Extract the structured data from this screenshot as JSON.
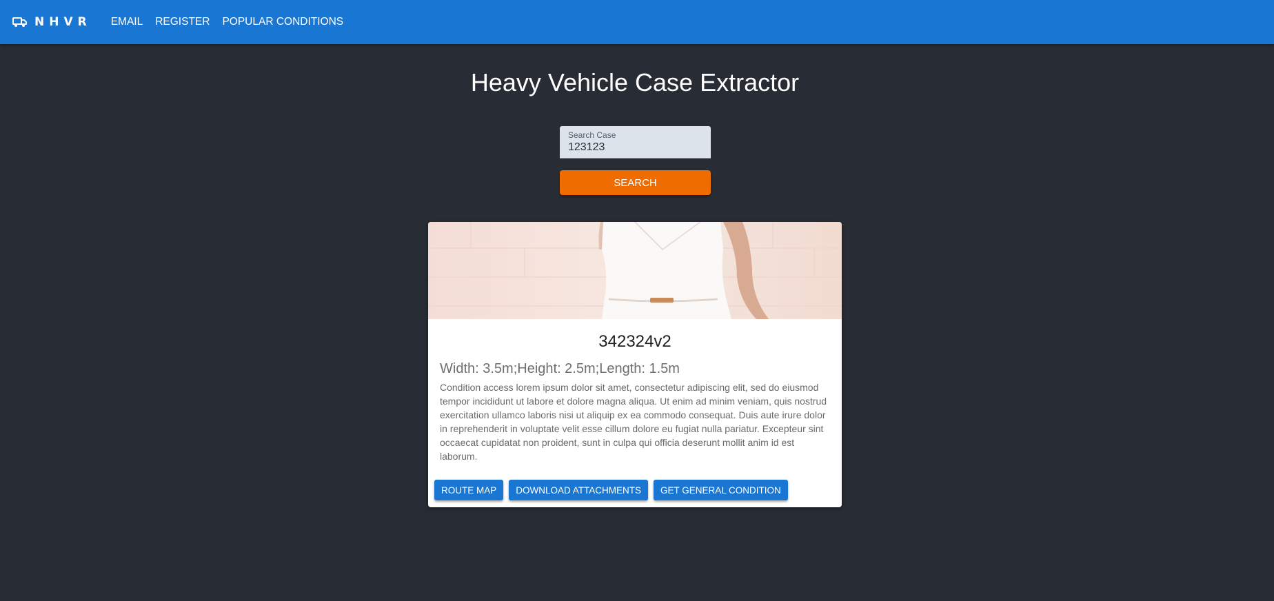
{
  "header": {
    "brand": "NHVR",
    "brand_icon": "truck-icon",
    "nav": [
      {
        "label": "EMAIL"
      },
      {
        "label": "REGISTER"
      },
      {
        "label": "POPULAR CONDITIONS"
      }
    ],
    "color": "#1976d2"
  },
  "main": {
    "title": "Heavy Vehicle Case Extractor",
    "search": {
      "label": "Search Case",
      "value": "123123"
    },
    "search_button": "SEARCH",
    "search_button_color": "#ef6c00"
  },
  "card": {
    "title": "342324v2",
    "dimensions": "Width: 3.5m;Height: 2.5m;Length: 1.5m",
    "description": "Condition access lorem ipsum dolor sit amet, consectetur adipiscing elit, sed do eiusmod tempor incididunt ut labore et dolore magna aliqua. Ut enim ad minim veniam, quis nostrud exercitation ullamco laboris nisi ut aliquip ex ea commodo consequat. Duis aute irure dolor in reprehenderit in voluptate velit esse cillum dolore eu fugiat nulla pariatur. Excepteur sint occaecat cupidatat non proident, sunt in culpa qui officia deserunt mollit anim id est laborum.",
    "actions": [
      {
        "label": "ROUTE MAP"
      },
      {
        "label": "DOWNLOAD ATTACHMENTS"
      },
      {
        "label": "GET GENERAL CONDITION"
      }
    ]
  },
  "colors": {
    "background": "#282c34",
    "card": "#ffffff"
  }
}
